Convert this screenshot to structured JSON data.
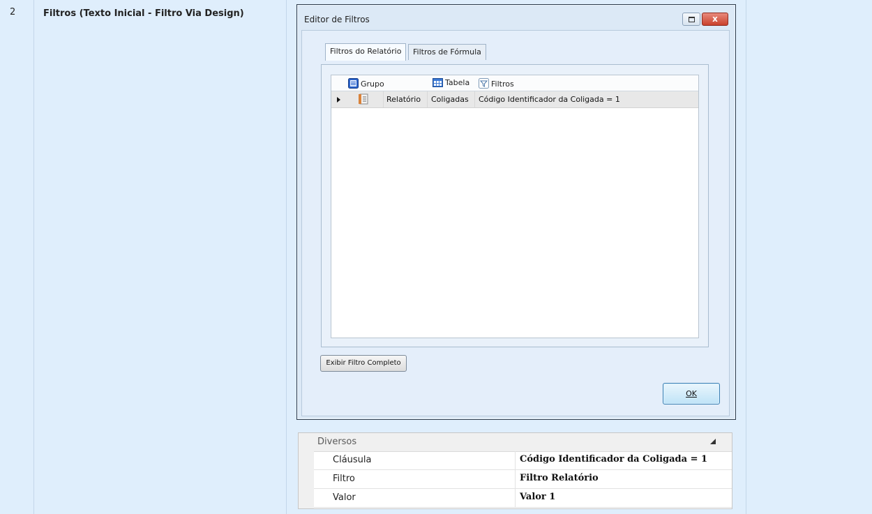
{
  "row": {
    "number": "2",
    "title": "Filtros (Texto Inicial - Filtro Via Design)"
  },
  "dialog": {
    "title": "Editor de Filtros",
    "close_glyph": "x",
    "tabs": [
      {
        "label": "Filtros do Relatório",
        "active": true
      },
      {
        "label": "Filtros de Fórmula",
        "active": false
      }
    ],
    "columns": {
      "grupo": "Grupo",
      "tabela": "Tabela",
      "filtros": "Filtros"
    },
    "rows": [
      {
        "grupo": "Relatório",
        "tabela": "Coligadas",
        "filtro": "Código Identificador da Coligada = 1"
      }
    ],
    "exibir_button": "Exibir Filtro Completo",
    "ok_button": "OK"
  },
  "properties": {
    "group": "Diversos",
    "rows": [
      {
        "key": "Cláusula",
        "value": "Código Identificador da Coligada = 1"
      },
      {
        "key": "Filtro",
        "value": "Filtro Relatório"
      },
      {
        "key": "Valor",
        "value": "Valor 1"
      }
    ]
  },
  "icons": [
    "grupo-icon",
    "tabela-icon",
    "filtro-icon",
    "row-arrow-icon",
    "report-icon",
    "restore-icon",
    "close-icon",
    "collapse-icon"
  ],
  "colors": {
    "background": "#dfeefc",
    "close_button": "#c9412c",
    "ok_border": "#3c7fb1"
  }
}
